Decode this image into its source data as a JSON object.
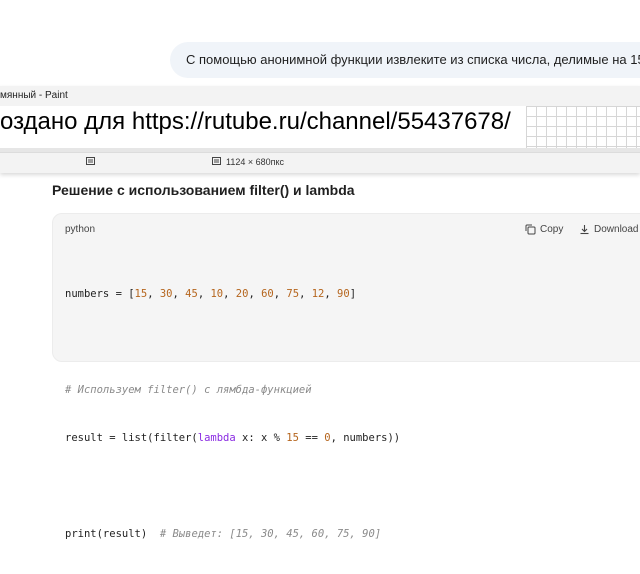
{
  "chat": {
    "user_message": "С помощью анонимной функции извлеките из списка числа, делимые на 15"
  },
  "paint": {
    "title": "мянный - Paint",
    "canvas_text": "оздано для https://rutube.ru/channel/55437678/",
    "image_size": "1124 × 680пкс"
  },
  "answer": {
    "heading": "Решение с использованием filter() и lambda",
    "code": {
      "language": "python",
      "copy_label": "Copy",
      "download_label": "Download",
      "lines": {
        "l1": {
          "a": "numbers = [",
          "n1": "15",
          "s1": ", ",
          "n2": "30",
          "s2": ", ",
          "n3": "45",
          "s3": ", ",
          "n4": "10",
          "s4": ", ",
          "n5": "20",
          "s5": ", ",
          "n6": "60",
          "s6": ", ",
          "n7": "75",
          "s7": ", ",
          "n8": "12",
          "s8": ", ",
          "n9": "90",
          "end": "]"
        },
        "l3": "# Используем filter() с лямбда-функцией",
        "l4": {
          "a": "result = list(filter(",
          "kw": "lambda",
          "b": " x: x % ",
          "n1": "15",
          "c": " == ",
          "n2": "0",
          "d": ", numbers))"
        },
        "l6": {
          "a": "print(result)",
          "comment": "  # Выведет: [15, 30, 45, 60, 75, 90]"
        }
      }
    }
  }
}
